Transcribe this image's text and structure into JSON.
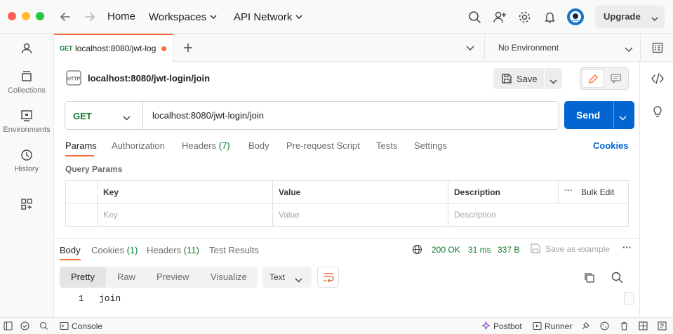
{
  "nav": {
    "home": "Home",
    "workspaces": "Workspaces",
    "api_network": "API Network",
    "upgrade": "Upgrade"
  },
  "sidebar": {
    "items": [
      {
        "label": "",
        "icon": "user-icon"
      },
      {
        "label": "Collections",
        "icon": "trash-collections-icon"
      },
      {
        "label": "Environments",
        "icon": "environments-icon"
      },
      {
        "label": "History",
        "icon": "history-icon"
      },
      {
        "label": "",
        "icon": "apps-icon"
      }
    ]
  },
  "tabs": {
    "active": {
      "method": "GET",
      "name": "localhost:8080/jwt-log"
    },
    "environment": "No Environment"
  },
  "request": {
    "title": "localhost:8080/jwt-login/join",
    "save_label": "Save",
    "method": "GET",
    "url": "localhost:8080/jwt-login/join",
    "send_label": "Send",
    "tabs": [
      {
        "label": "Params",
        "count": ""
      },
      {
        "label": "Authorization",
        "count": ""
      },
      {
        "label": "Headers",
        "count": "(7)"
      },
      {
        "label": "Body",
        "count": ""
      },
      {
        "label": "Pre-request Script",
        "count": ""
      },
      {
        "label": "Tests",
        "count": ""
      },
      {
        "label": "Settings",
        "count": ""
      }
    ],
    "cookies_link": "Cookies",
    "query_params_label": "Query Params",
    "table": {
      "headers": [
        "Key",
        "Value",
        "Description"
      ],
      "bulk_edit": "Bulk Edit",
      "placeholders": [
        "Key",
        "Value",
        "Description"
      ]
    }
  },
  "response": {
    "tabs": [
      {
        "label": "Body",
        "count": ""
      },
      {
        "label": "Cookies",
        "count": "(1)"
      },
      {
        "label": "Headers",
        "count": "(11)"
      },
      {
        "label": "Test Results",
        "count": ""
      }
    ],
    "status": "200 OK",
    "time": "31 ms",
    "size": "337 B",
    "save_example": "Save as example",
    "formats": [
      "Pretty",
      "Raw",
      "Preview",
      "Visualize"
    ],
    "text_type": "Text",
    "line_number": "1",
    "body_line": "join"
  },
  "statusbar": {
    "console": "Console",
    "postbot": "Postbot",
    "runner": "Runner"
  },
  "colors": {
    "accent": "#ff6c37",
    "send": "#0265d2",
    "method_get": "#0c7a2c"
  }
}
